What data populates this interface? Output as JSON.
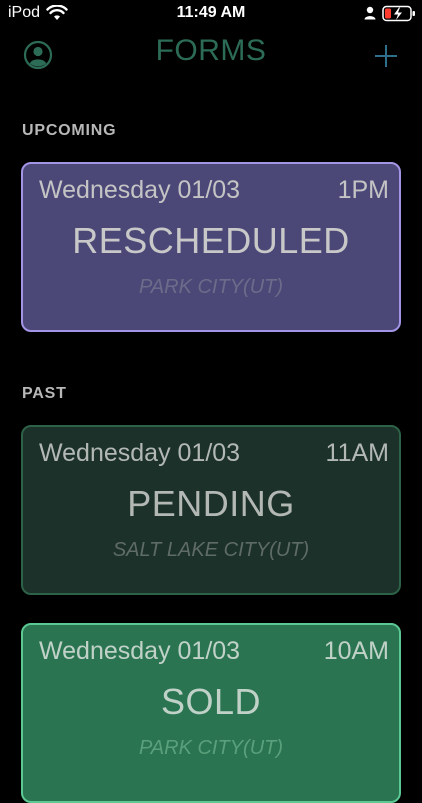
{
  "status_bar": {
    "carrier": "iPod",
    "time": "11:49 AM"
  },
  "header": {
    "title": "FORMS"
  },
  "sections": {
    "upcoming_label": "UPCOMING",
    "past_label": "PAST"
  },
  "cards": [
    {
      "day": "Wednesday  01/03",
      "time": "1PM",
      "status": "RESCHEDULED",
      "location": "PARK CITY(UT)"
    },
    {
      "day": "Wednesday  01/03",
      "time": "11AM",
      "status": "PENDING",
      "location": "SALT LAKE CITY(UT)"
    },
    {
      "day": "Wednesday  01/03",
      "time": "10AM",
      "status": "SOLD",
      "location": "PARK CITY(UT)"
    }
  ],
  "colors": {
    "accent": "#2c6b55",
    "rescheduled": "#4b4878",
    "pending": "#1b3129",
    "sold": "#2b7451"
  },
  "icons": {
    "profile": "person-circle-icon",
    "add": "plus-icon",
    "wifi": "wifi-icon",
    "battery": "battery-charging-icon"
  }
}
